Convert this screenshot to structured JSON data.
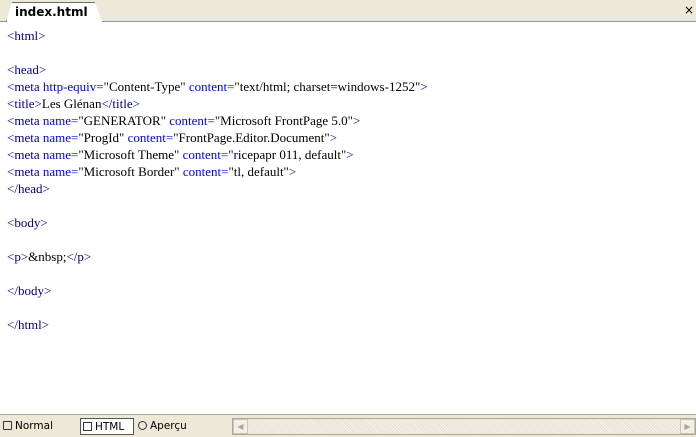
{
  "tab": {
    "label": "index.html",
    "close": "×"
  },
  "code_lines": [
    [
      {
        "t": "tag",
        "v": "<html>"
      }
    ],
    [],
    [
      {
        "t": "tag",
        "v": "<head>"
      }
    ],
    [
      {
        "t": "tag",
        "v": "<meta "
      },
      {
        "t": "attr",
        "v": "http-equiv="
      },
      {
        "t": "txt",
        "v": "\"Content-Type\" "
      },
      {
        "t": "attr",
        "v": "content="
      },
      {
        "t": "txt",
        "v": "\"text/html; charset=windows-1252\""
      },
      {
        "t": "tag",
        "v": ">"
      }
    ],
    [
      {
        "t": "tag",
        "v": "<title>"
      },
      {
        "t": "txt",
        "v": "Les Glénan"
      },
      {
        "t": "tag",
        "v": "</title>"
      }
    ],
    [
      {
        "t": "tag",
        "v": "<meta "
      },
      {
        "t": "attr",
        "v": "name="
      },
      {
        "t": "txt",
        "v": "\"GENERATOR\" "
      },
      {
        "t": "attr",
        "v": "content="
      },
      {
        "t": "txt",
        "v": "\"Microsoft FrontPage 5.0\""
      },
      {
        "t": "tag",
        "v": ">"
      }
    ],
    [
      {
        "t": "tag",
        "v": "<meta "
      },
      {
        "t": "attr",
        "v": "name="
      },
      {
        "t": "txt",
        "v": "\"ProgId\" "
      },
      {
        "t": "attr",
        "v": "content="
      },
      {
        "t": "txt",
        "v": "\"FrontPage.Editor.Document\""
      },
      {
        "t": "tag",
        "v": ">"
      }
    ],
    [
      {
        "t": "tag",
        "v": "<meta "
      },
      {
        "t": "attr",
        "v": "name="
      },
      {
        "t": "txt",
        "v": "\"Microsoft Theme\" "
      },
      {
        "t": "attr",
        "v": "content="
      },
      {
        "t": "txt",
        "v": "\"ricepapr 011, default\""
      },
      {
        "t": "tag",
        "v": ">"
      }
    ],
    [
      {
        "t": "tag",
        "v": "<meta "
      },
      {
        "t": "attr",
        "v": "name="
      },
      {
        "t": "txt",
        "v": "\"Microsoft Border\" "
      },
      {
        "t": "attr",
        "v": "content="
      },
      {
        "t": "txt",
        "v": "\"tl, default\""
      },
      {
        "t": "tag",
        "v": ">"
      }
    ],
    [
      {
        "t": "tag",
        "v": "</head>"
      }
    ],
    [],
    [
      {
        "t": "tag",
        "v": "<body>"
      }
    ],
    [],
    [
      {
        "t": "tag",
        "v": "<p>"
      },
      {
        "t": "txt",
        "v": "&nbsp;"
      },
      {
        "t": "tag",
        "v": "</p>"
      }
    ],
    [],
    [
      {
        "t": "tag",
        "v": "</body>"
      }
    ],
    [],
    [
      {
        "t": "tag",
        "v": "</html>"
      }
    ]
  ],
  "status_bar": {
    "views": [
      {
        "label": "Normal",
        "icon": "normal-view-icon",
        "active": false
      },
      {
        "label": "HTML",
        "icon": "html-view-icon",
        "active": true
      },
      {
        "label": "Aperçu",
        "icon": "preview-icon",
        "active": false
      }
    ],
    "scroll_left": "◀",
    "scroll_right": "▶"
  }
}
